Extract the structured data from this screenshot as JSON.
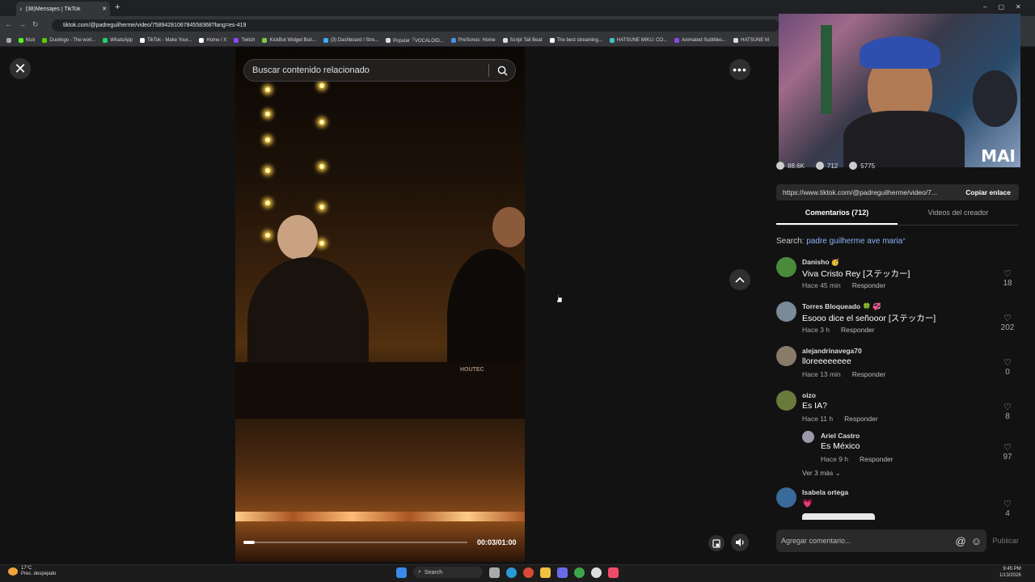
{
  "browser": {
    "tab_title": "(38)Mensajes | TikTok",
    "url": "tiktok.com/@padreguilherme/video/7589428106784558368?lang=es-419",
    "bookmarks": [
      "Kick",
      "Duolingo - The worl...",
      "WhatsApp",
      "TikTok - Make Your...",
      "Home / X",
      "Twitch",
      "KickBot Widget Buil...",
      "(3) Dashboard / Stre...",
      "Popular「VOCALOID...",
      "PreSonus: Home",
      "Script Tail Beat",
      "The best streaming...",
      "HATSUNE MIKU: CO...",
      "Animated Subtitles...",
      "HATSUNE M"
    ]
  },
  "player": {
    "search_placeholder": "Buscar contenido relacionado",
    "time": "00:03/01:00",
    "progress": 0.05,
    "overlay_text": "HOUTEC"
  },
  "webcam": {
    "label": "MAI"
  },
  "stats": {
    "likes": "88.6K",
    "comments": "712",
    "saves": "5775"
  },
  "share": {
    "link": "https://www.tiktok.com/@padreguilherme/video/7...",
    "copy_label": "Copiar enlace"
  },
  "tabs": {
    "comments": "Comentarios (712)",
    "creator_videos": "Videos del creador"
  },
  "search_suggestion": {
    "prefix": "Search:",
    "query": "padre guilherme ave maria"
  },
  "reply_label": "Responder",
  "comments": [
    {
      "name": "Danisho 🥳",
      "text": "Viva Cristo Rey [ステッカー]",
      "time": "Hace 45 min",
      "likes": "18",
      "avatar_color": "#4a8a3a"
    },
    {
      "name": "Torres Bloqueado 🍀 💞",
      "text": "Esooo dice el señooor [ステッカー]",
      "time": "Hace 3 h",
      "likes": "202",
      "avatar_color": "#7a8a9a"
    },
    {
      "name": "alejandrinavega70",
      "text": "lloreeeeeeee",
      "time": "Hace 13 min",
      "likes": "0",
      "avatar_color": "#8a7a6a"
    },
    {
      "name": "oizo",
      "text": "Es IA?",
      "time": "Hace 11 h",
      "likes": "8",
      "avatar_color": "#6a7a3a"
    }
  ],
  "reply": {
    "name": "Ariel Castro",
    "text": "Es México",
    "time": "Hace 9 h",
    "likes": "97",
    "avatar_color": "#9a9aaa"
  },
  "more_replies": "Ver 3 más",
  "last_comment": {
    "name": "Isabela ortega",
    "text": "💗",
    "likes": "4",
    "avatar_color": "#3a6a9a"
  },
  "composer": {
    "placeholder": "Agregar comentario...",
    "publish": "Publicar"
  },
  "taskbar": {
    "temp": "17°C",
    "weather": "Prec. despejado",
    "search": "Search",
    "time": "9:45 PM",
    "date": "1/13/2026"
  }
}
